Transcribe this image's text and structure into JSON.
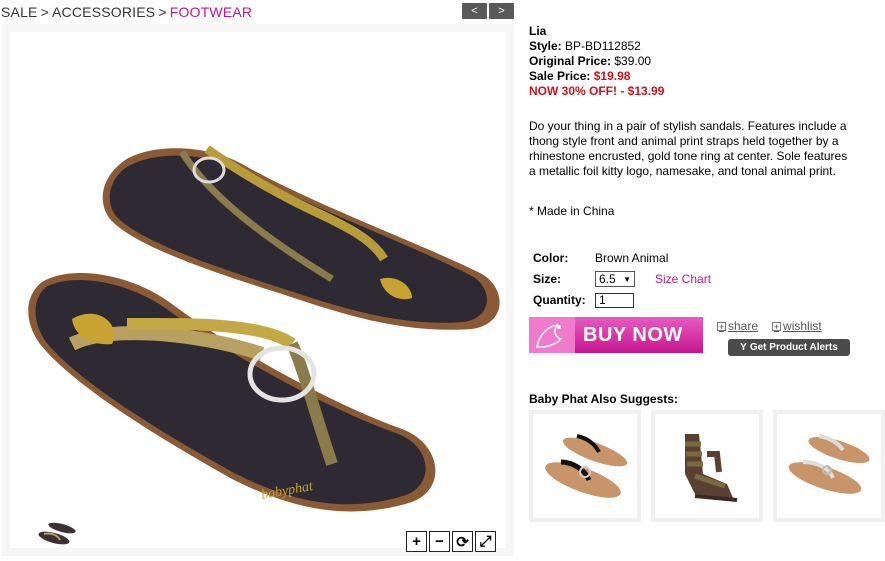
{
  "breadcrumb": {
    "items": [
      "SALE",
      "ACCESSORIES"
    ],
    "current": "FOOTWEAR",
    "separator": ">"
  },
  "nav": {
    "prev": "<",
    "next": ">"
  },
  "product": {
    "name": "Lia",
    "style_label": "Style:",
    "style_value": "BP-BD112852",
    "original_label": "Original Price:",
    "original_value": "$39.00",
    "sale_label": "Sale Price:",
    "sale_value": "$19.98",
    "promo": "NOW 30% OFF! - $13.99",
    "description": "Do your thing in a pair of stylish sandals. Features include a thong style front and animal print straps held together by a rhinestone encrusted, gold tone ring at center. Sole features a metallic foil kitty logo, namesake, and tonal animal print.",
    "made_in": "* Made in China",
    "brand_script": "babyphat"
  },
  "options": {
    "color_label": "Color:",
    "color_value": "Brown Animal",
    "size_label": "Size:",
    "size_value": "6.5",
    "size_chart": "Size Chart",
    "quantity_label": "Quantity:",
    "quantity_value": "1"
  },
  "actions": {
    "buy_now": "BUY NOW",
    "share": "share",
    "wishlist": "wishlist",
    "alerts": "Get Product Alerts"
  },
  "zoom": {
    "in": "+",
    "out": "−",
    "rotate": "⟳",
    "fullscreen": "⤢"
  },
  "suggestions": {
    "title": "Baby Phat Also Suggests:",
    "count": 3
  },
  "colors": {
    "accent": "#c0168e",
    "sale_red": "#d0111c",
    "button_dark": "#4b4b4b"
  }
}
